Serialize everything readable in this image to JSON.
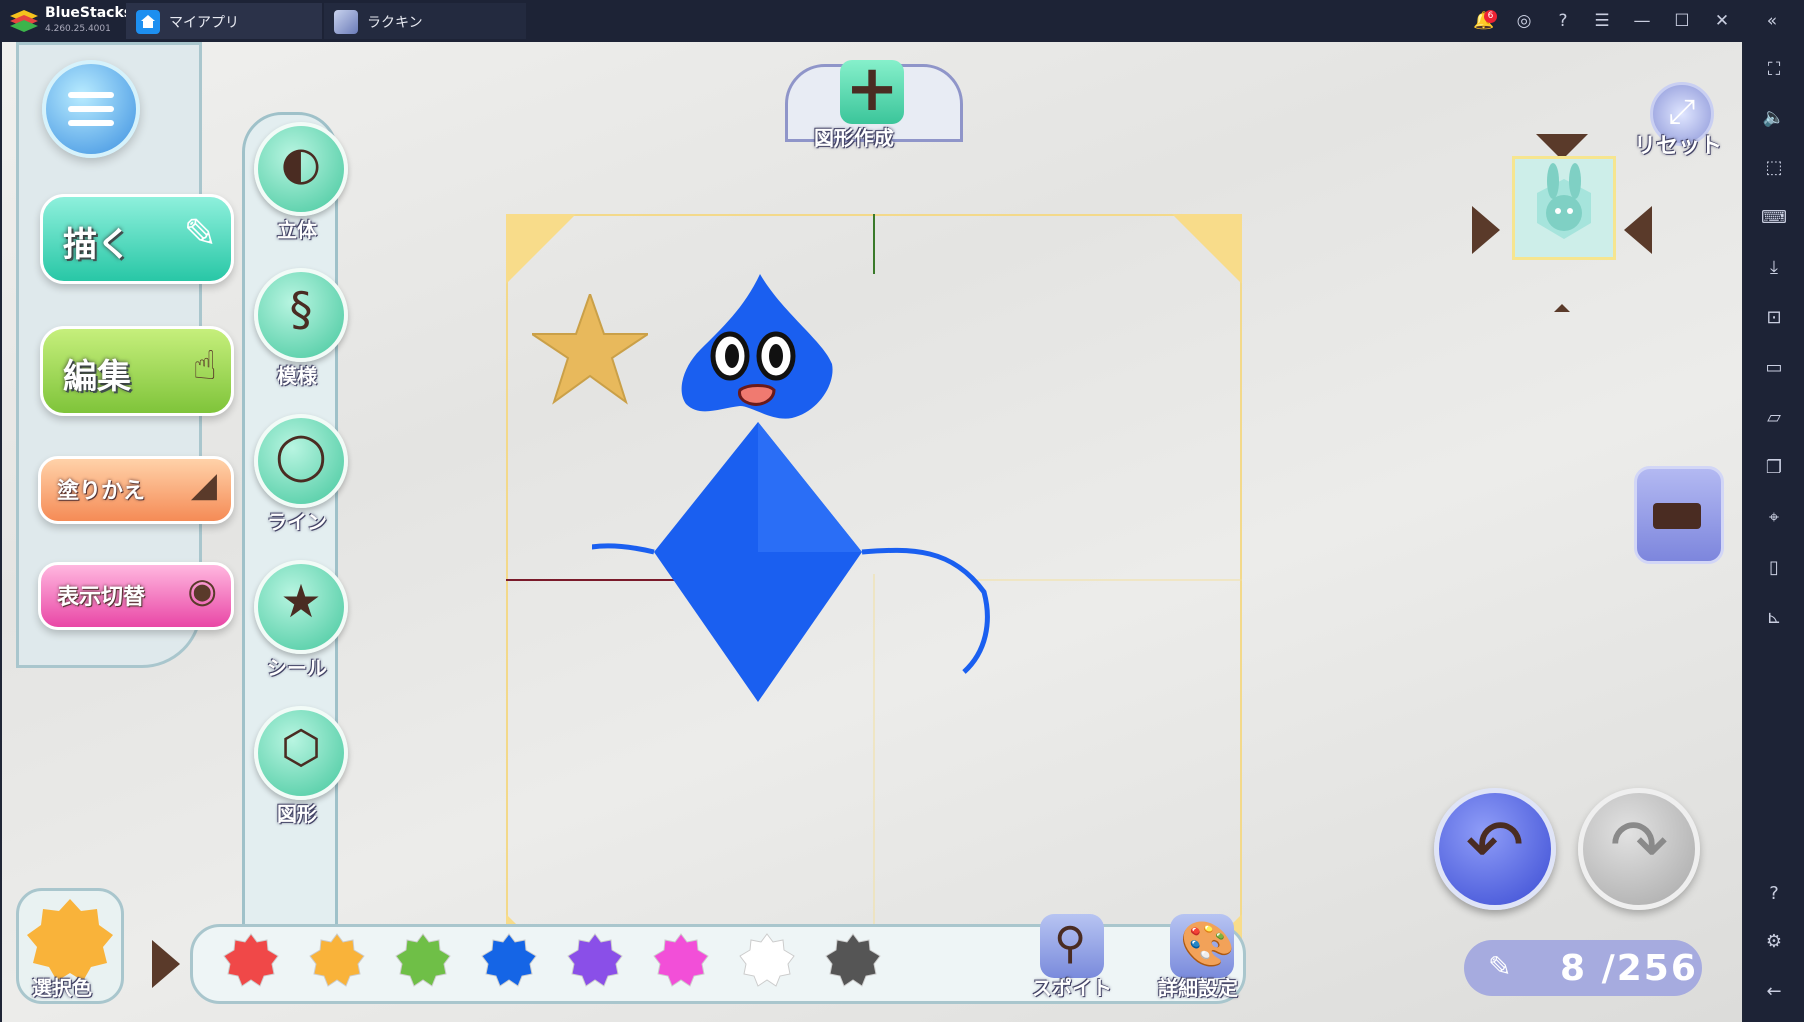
{
  "titlebar": {
    "app_name": "BlueStacks",
    "version": "4.260.25.4001",
    "tabs": [
      {
        "label": "マイアプリ",
        "icon": "home-icon"
      },
      {
        "label": "ラクキン",
        "icon": "game-thumbnail-icon"
      }
    ],
    "notification_count": "6",
    "icons": [
      "bell-icon",
      "account-icon",
      "help-icon",
      "menu-icon",
      "minimize-icon",
      "maximize-icon",
      "close-icon",
      "collapse-sidebar-icon"
    ]
  },
  "sidebar": {
    "icons": [
      "fullscreen-icon",
      "volume-icon",
      "pointer-icon",
      "keyboard-icon",
      "apk-install-icon",
      "screenshot-icon",
      "record-icon",
      "folder-icon",
      "multi-instance-icon",
      "location-icon",
      "shake-icon",
      "rotate-icon",
      "help-icon",
      "settings-icon",
      "back-icon"
    ]
  },
  "game": {
    "modes": {
      "draw": "描く",
      "edit": "編集",
      "recolor": "塗りかえ",
      "toggle_view": "表示切替"
    },
    "tools": [
      "立体",
      "模様",
      "ライン",
      "シール",
      "図形"
    ],
    "shape_create_label": "図形作成",
    "reset_label": "リセット",
    "selected_color_label": "選択色",
    "selected_color": "#f9b33a",
    "palette": [
      "#f04848",
      "#f9b33a",
      "#6fbf47",
      "#1565e6",
      "#8a4fe8",
      "#f24fd8",
      "#ffffff",
      "#555555"
    ],
    "dropper_label": "スポイト",
    "detail_label": "詳細設定",
    "counter": "8 /256",
    "colors": {
      "character_blue": "#1a5ff0",
      "frame_yellow": "#f3d98a",
      "star_gold": "#e8b95c"
    }
  }
}
